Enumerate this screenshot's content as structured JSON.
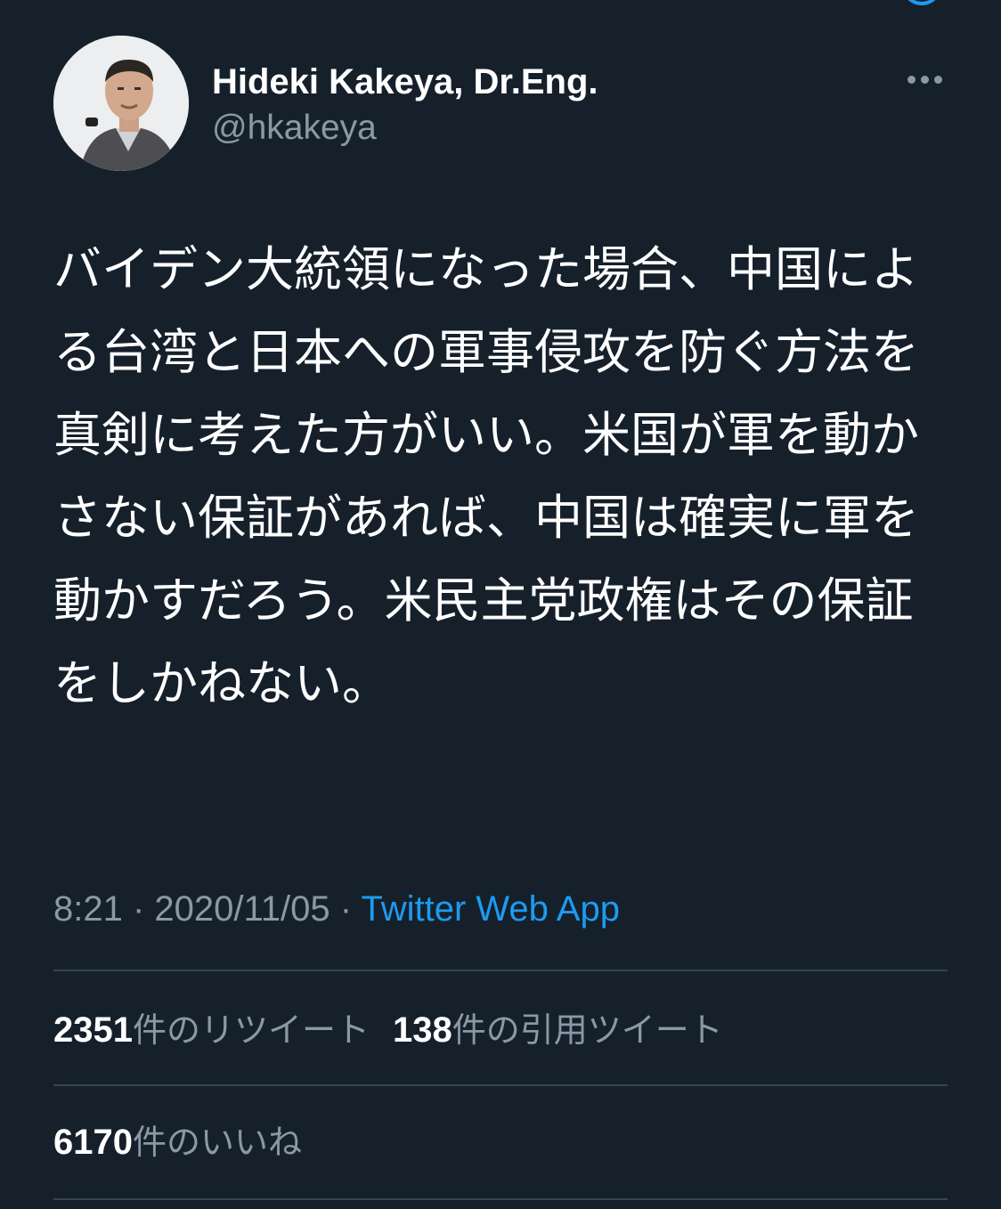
{
  "tweet": {
    "author": {
      "display_name": "Hideki Kakeya, Dr.Eng.",
      "handle": "@hkakeya"
    },
    "text": "バイデン大統領になった場合、中国による台湾と日本への軍事侵攻を防ぐ方法を真剣に考えた方がいい。米国が軍を動かさない保証があれば、中国は確実に軍を動かすだろう。米民主党政権はその保証をしかねない。",
    "time": "8:21",
    "date": "2020/11/05",
    "separator": " · ",
    "source": "Twitter Web App"
  },
  "stats": {
    "retweets": {
      "count": "2351",
      "label": "件のリツイート"
    },
    "quote_tweets": {
      "count": "138",
      "label": "件の引用ツイート"
    },
    "likes": {
      "count": "6170",
      "label": "件のいいね"
    }
  },
  "icons": {
    "more": "more-horizontal-icon",
    "avatar": "profile-photo"
  },
  "colors": {
    "background": "#15202b",
    "text_primary": "#ffffff",
    "text_secondary": "#8b98a5",
    "accent": "#1d9bf0",
    "divider": "#38444d"
  }
}
